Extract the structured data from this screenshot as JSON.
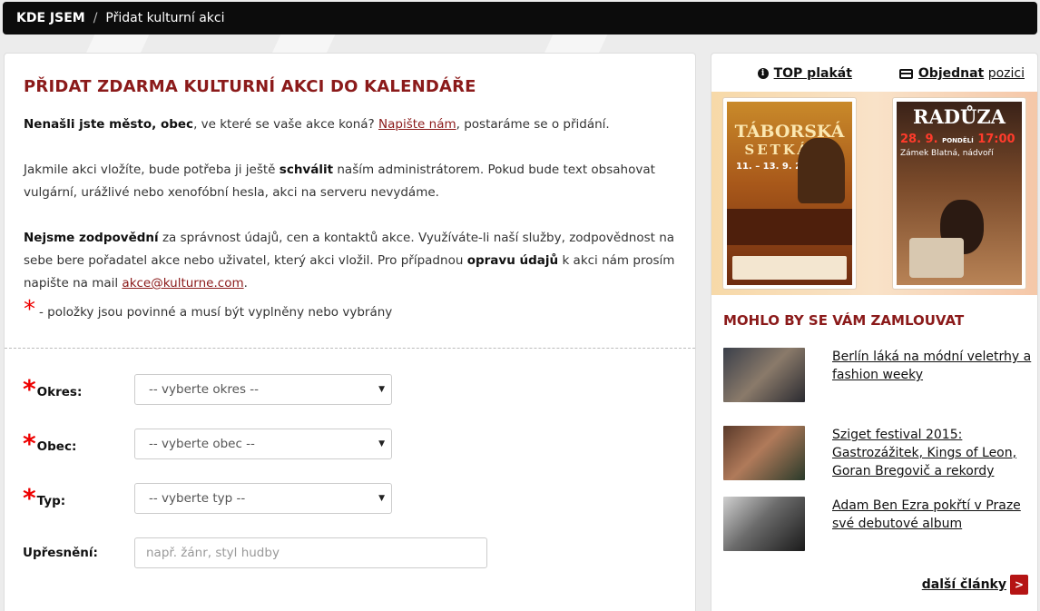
{
  "breadcrumb": {
    "where_label": "KDE JSEM",
    "separator": "/",
    "current": "Přidat kulturní akci"
  },
  "main": {
    "title": "PŘIDAT ZDARMA KULTURNÍ AKCI DO KALENDÁŘE",
    "p1_bold": "Nenašli jste město, obec",
    "p1_text": ", ve které se vaše akce koná?",
    "p1_link": "Napište nám",
    "p1_end": ", postaráme se o přidání.",
    "p2_a": "Jakmile akci vložíte, bude potřeba ji ještě",
    "p2_bold": "schválit",
    "p2_b": "naším administrátorem. Pokud bude text obsahovat vulgární, urážlivé nebo xenofóbní hesla, akci na serveru nevydáme.",
    "p3_bold": "Nejsme zodpovědní",
    "p3_a": "za správnost údajů, cen a kontaktů akce. Využíváte-li naší služby, zodpovědnost na sebe bere pořadatel akce nebo uživatel, který akci vložil. Pro případnou",
    "p3_bold2": "opravu údajů",
    "p3_b": "k akci nám prosím napište na mail",
    "p3_email": "akce@kulturne.com",
    "p3_end": ".",
    "required_star": "*",
    "required_note": "- položky jsou povinné a musí být vyplněny nebo vybrány"
  },
  "form": {
    "okres_label": "Okres:",
    "okres_value": "-- vyberte okres --",
    "obec_label": "Obec:",
    "obec_value": "-- vyberte obec --",
    "typ_label": "Typ:",
    "typ_value": "-- vyberte typ --",
    "upresneni_label": "Upřesnění:",
    "upresneni_placeholder": "např. žánr, styl hudby"
  },
  "sidebar": {
    "top_bold": "TOP plakát",
    "order_bold": "Objednat",
    "order_rest": "pozici",
    "poster1": {
      "title1": "TÁBORSKÁ",
      "title2": "SETKÁNÍ",
      "dates": "11. – 13. 9. 2015"
    },
    "poster2": {
      "title": "RADŮZA",
      "date": "28. 9.",
      "day": "PONDĚLÍ",
      "time": "17:00",
      "venue": "Zámek Blatná, nádvoří"
    },
    "section_title": "MOHLO BY SE VÁM ZAMLOUVAT",
    "articles": [
      {
        "title": "Berlín láká na módní veletrhy a fashion weeky"
      },
      {
        "title": "Sziget festival 2015: Gastrozážitek, Kings of Leon, Goran Bregovič a rekordy"
      },
      {
        "title": "Adam Ben Ezra pokřtí v Praze své debutové album"
      }
    ],
    "more_label": "další články",
    "more_arrow": ">"
  }
}
